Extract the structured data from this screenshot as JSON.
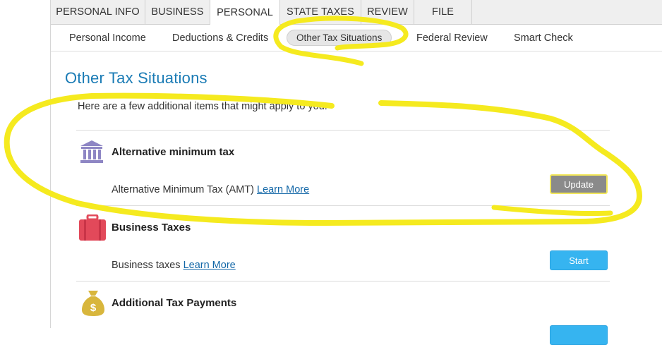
{
  "top_tabs": [
    {
      "label": "PERSONAL INFO",
      "active": false
    },
    {
      "label": "BUSINESS",
      "active": false
    },
    {
      "label": "PERSONAL",
      "active": true
    },
    {
      "label": "STATE TAXES",
      "active": false
    },
    {
      "label": "REVIEW",
      "active": false
    },
    {
      "label": "FILE",
      "active": false
    }
  ],
  "subnav": [
    {
      "label": "Personal Income",
      "selected": false
    },
    {
      "label": "Deductions & Credits",
      "selected": false
    },
    {
      "label": "Other Tax Situations",
      "selected": true
    },
    {
      "label": "Federal Review",
      "selected": false
    },
    {
      "label": "Smart Check",
      "selected": false
    }
  ],
  "page": {
    "title": "Other Tax Situations",
    "intro": "Here are a few additional items that might apply to you."
  },
  "items": [
    {
      "icon": "bank-building-icon",
      "title": "Alternative minimum tax",
      "desc": "Alternative Minimum Tax (AMT)",
      "link": "Learn More",
      "button": "Update"
    },
    {
      "icon": "briefcase-icon",
      "title": "Business Taxes",
      "desc": "Business taxes",
      "link": "Learn More",
      "button": "Start"
    },
    {
      "icon": "money-bag-icon",
      "title": "Additional Tax Payments",
      "desc": "",
      "link": "",
      "button": ""
    }
  ],
  "colors": {
    "title_blue": "#1a7bb5",
    "link_blue": "#1468a8",
    "start_button": "#36b4f0",
    "update_button": "#8a8a8a",
    "highlighter_yellow": "#f5ea1f",
    "icon_purple": "#8e86c4",
    "icon_red": "#e2495a",
    "icon_gold": "#d8b63c"
  }
}
